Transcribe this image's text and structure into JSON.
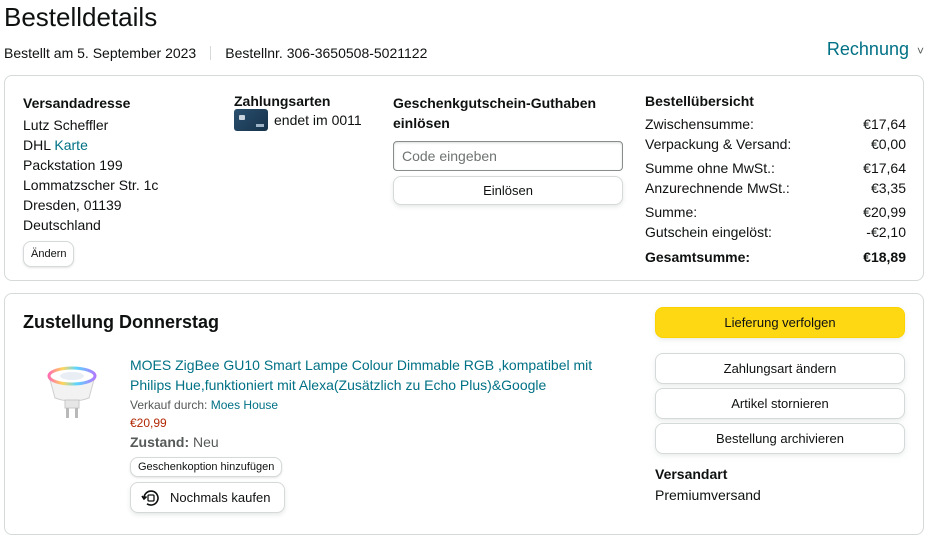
{
  "page": {
    "title": "Bestelldetails",
    "ordered_on": "Bestellt am 5. September 2023",
    "order_number": "Bestellnr. 306-3650508-5021122",
    "invoice_label": "Rechnung",
    "invoice_chevron": "˅"
  },
  "shipping_address": {
    "heading": "Versandadresse",
    "name": "Lutz Scheffler",
    "dhl_prefix": "DHL",
    "dhl_link": "Karte",
    "line1": "Packstation 199",
    "line2": "Lommatzscher Str. 1c",
    "line3": "Dresden, 01139",
    "country": "Deutschland",
    "change_button": "Ändern"
  },
  "payment": {
    "heading": "Zahlungsarten",
    "card_text": "endet im 0011"
  },
  "gift_card": {
    "heading": "Geschenkgutschein-Guthaben einlösen",
    "input_placeholder": "Code eingeben",
    "input_value": "",
    "redeem_button": "Einlösen"
  },
  "summary": {
    "heading": "Bestellübersicht",
    "rows": [
      {
        "label": "Zwischensumme:",
        "value": "€17,64"
      },
      {
        "label": "Verpackung & Versand:",
        "value": "€0,00"
      },
      {
        "label": "Summe ohne MwSt.:",
        "value": "€17,64"
      },
      {
        "label": "Anzurechnende MwSt.:",
        "value": "€3,35"
      },
      {
        "label": "Summe:",
        "value": "€20,99"
      },
      {
        "label": "Gutschein eingelöst:",
        "value": "-€2,10"
      }
    ],
    "total_label": "Gesamtsumme:",
    "total_value": "€18,89"
  },
  "shipment": {
    "title": "Zustellung Donnerstag",
    "product": {
      "title": "MOES ZigBee GU10 Smart Lampe Colour Dimmable RGB ,kompatibel mit Philips Hue,funktioniert mit Alexa(Zusätzlich zu Echo Plus)&Google",
      "seller_prefix": "Verkauf durch:",
      "seller_name": "Moes House",
      "price": "€20,99",
      "condition_label": "Zustand:",
      "condition_value": "Neu",
      "gift_option_button": "Geschenkoption hinzufügen",
      "buy_again_button": "Nochmals kaufen"
    },
    "actions": {
      "track": "Lieferung verfolgen",
      "change_payment": "Zahlungsart ändern",
      "cancel": "Artikel stornieren",
      "archive": "Bestellung archivieren"
    },
    "shipping_method_heading": "Versandart",
    "shipping_method_value": "Premiumversand"
  },
  "colors": {
    "link": "#007185",
    "primary_button": "#ffd814",
    "price": "#b12704",
    "border": "#d5d9d9"
  }
}
